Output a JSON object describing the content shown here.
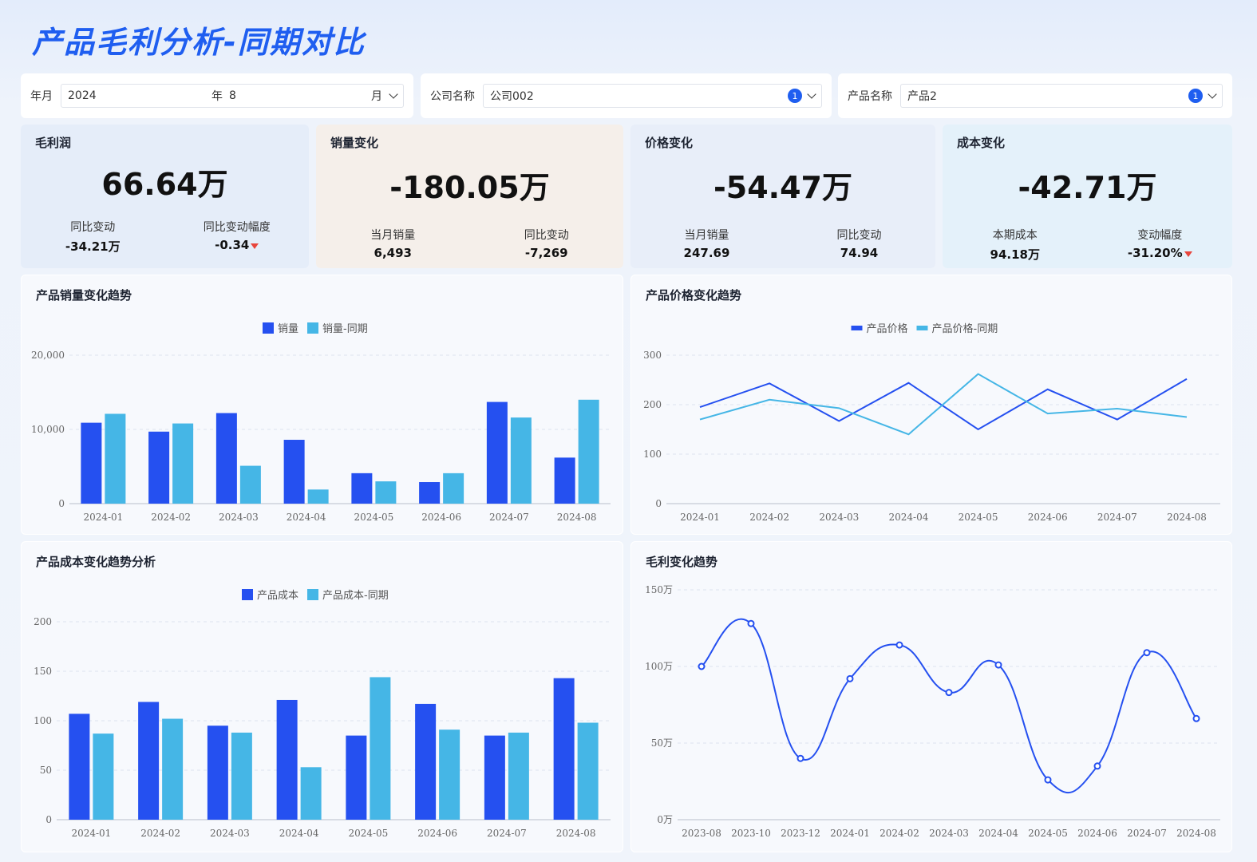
{
  "header": {
    "title": "产品毛利分析-同期对比"
  },
  "filters": {
    "period_label": "年月",
    "year_value": "2024",
    "year_unit": "年",
    "month_value": "8",
    "month_unit": "月",
    "company_label": "公司名称",
    "company_value": "公司002",
    "company_count": "1",
    "product_label": "产品名称",
    "product_value": "产品2",
    "product_count": "1"
  },
  "kpis": {
    "profit": {
      "title": "毛利润",
      "value": "66.64万",
      "sub1_label": "同比变动",
      "sub1_value": "-34.21万",
      "sub2_label": "同比变动幅度",
      "sub2_value": "-0.34"
    },
    "volume": {
      "title": "销量变化",
      "value": "-180.05万",
      "sub1_label": "当月销量",
      "sub1_value": "6,493",
      "sub2_label": "同比变动",
      "sub2_value": "-7,269"
    },
    "price": {
      "title": "价格变化",
      "value": "-54.47万",
      "sub1_label": "当月销量",
      "sub1_value": "247.69",
      "sub2_label": "同比变动",
      "sub2_value": "74.94"
    },
    "cost": {
      "title": "成本变化",
      "value": "-42.71万",
      "sub1_label": "本期成本",
      "sub1_value": "94.18万",
      "sub2_label": "变动幅度",
      "sub2_value": "-31.20%"
    }
  },
  "colors": {
    "primary": "#2550f0",
    "secondary": "#45b6e6",
    "accent": "#1f5ef0",
    "down": "#e8453c"
  },
  "chart_data": [
    {
      "id": "sales",
      "type": "bar",
      "title": "产品销量变化趋势",
      "categories": [
        "2024-01",
        "2024-02",
        "2024-03",
        "2024-04",
        "2024-05",
        "2024-06",
        "2024-07",
        "2024-08"
      ],
      "series": [
        {
          "name": "销量",
          "values": [
            10900,
            9700,
            12200,
            8600,
            4100,
            2900,
            13700,
            6200
          ]
        },
        {
          "name": "销量-同期",
          "values": [
            12100,
            10800,
            5100,
            1900,
            3000,
            4100,
            11600,
            14000
          ]
        }
      ],
      "yticks": [
        "0",
        "10,000",
        "20,000"
      ],
      "ylim": [
        0,
        20000
      ],
      "grid": true,
      "legend": "top-center"
    },
    {
      "id": "price",
      "type": "line",
      "title": "产品价格变化趋势",
      "categories": [
        "2024-01",
        "2024-02",
        "2024-03",
        "2024-04",
        "2024-05",
        "2024-06",
        "2024-07",
        "2024-08"
      ],
      "series": [
        {
          "name": "产品价格",
          "values": [
            195,
            243,
            167,
            244,
            150,
            231,
            170,
            252
          ]
        },
        {
          "name": "产品价格-同期",
          "values": [
            170,
            210,
            193,
            140,
            262,
            182,
            192,
            175
          ]
        }
      ],
      "yticks": [
        "0",
        "100",
        "200",
        "300"
      ],
      "ylim": [
        0,
        300
      ],
      "grid": true,
      "legend": "top-center"
    },
    {
      "id": "cost",
      "type": "bar",
      "title": "产品成本变化趋势分析",
      "categories": [
        "2024-01",
        "2024-02",
        "2024-03",
        "2024-04",
        "2024-05",
        "2024-06",
        "2024-07",
        "2024-08"
      ],
      "series": [
        {
          "name": "产品成本",
          "values": [
            107,
            119,
            95,
            121,
            85,
            117,
            85,
            143
          ]
        },
        {
          "name": "产品成本-同期",
          "values": [
            87,
            102,
            88,
            53,
            144,
            91,
            88,
            98
          ]
        }
      ],
      "yticks": [
        "0",
        "50",
        "100",
        "150",
        "200"
      ],
      "ylim": [
        0,
        200
      ],
      "grid": true,
      "legend": "top-center"
    },
    {
      "id": "margin",
      "type": "line",
      "title": "毛利变化趋势",
      "categories": [
        "2023-08",
        "2023-10",
        "2023-12",
        "2024-01",
        "2024-02",
        "2024-03",
        "2024-04",
        "2024-05",
        "2024-06",
        "2024-07",
        "2024-08"
      ],
      "series": [
        {
          "values": [
            100,
            128,
            40,
            92,
            114,
            83,
            101,
            26,
            35,
            109,
            66
          ]
        }
      ],
      "yticks": [
        "0万",
        "50万",
        "100万",
        "150万"
      ],
      "ylim": [
        0,
        150
      ],
      "grid": true,
      "smooth": true
    }
  ]
}
